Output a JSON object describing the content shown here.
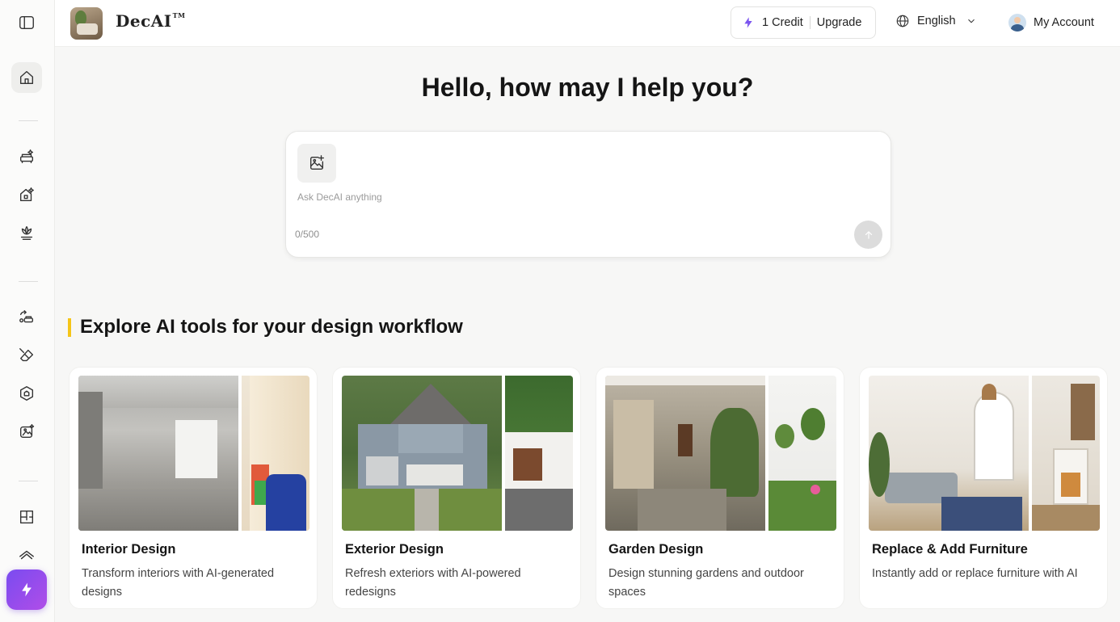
{
  "app": {
    "brand": "DecAI",
    "trademark": "TM"
  },
  "header": {
    "credits_label": "1 Credit",
    "upgrade_label": "Upgrade",
    "language": "English",
    "account_label": "My Account"
  },
  "sidebar": {
    "icons": [
      "sidebar-toggle-icon",
      "home-icon",
      "interior-design-icon",
      "exterior-design-icon",
      "garden-design-icon",
      "replace-furniture-icon",
      "remove-object-icon",
      "style-transfer-icon",
      "photo-enhance-icon",
      "floor-plan-icon",
      "roof-icon",
      "upgrade-bolt-icon"
    ]
  },
  "main": {
    "hero_title": "Hello, how may I help you?",
    "prompt": {
      "placeholder": "Ask DecAI anything",
      "counter": "0/500"
    },
    "section_title": "Explore AI tools for your design workflow",
    "cards": [
      {
        "title": "Interior Design",
        "description": "Transform interiors with AI-generated designs"
      },
      {
        "title": "Exterior Design",
        "description": "Refresh exteriors with AI-powered redesigns"
      },
      {
        "title": "Garden Design",
        "description": "Design stunning gardens and outdoor spaces"
      },
      {
        "title": "Replace & Add Furniture",
        "description": "Instantly add or replace furniture with AI"
      }
    ]
  },
  "colors": {
    "accent_purple": "#7b55ef",
    "section_marker_yellow": "#f5c518",
    "background": "#f7f7f6"
  }
}
